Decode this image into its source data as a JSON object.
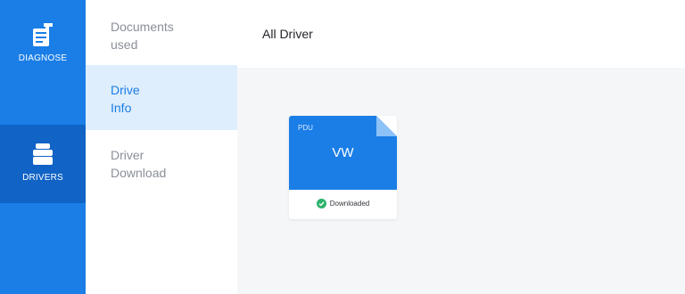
{
  "rail": {
    "items": [
      {
        "label": "DIAGNOSE",
        "icon": "diagnose-icon"
      },
      {
        "label": "DRIVERS",
        "icon": "drivers-icon",
        "active": true
      }
    ]
  },
  "submenu": {
    "items": [
      {
        "label": "Documents\nused"
      },
      {
        "label": "Drive\nInfo",
        "active": true
      },
      {
        "label": "Driver\nDownload"
      }
    ]
  },
  "main": {
    "title": "All Driver",
    "drivers": [
      {
        "tag": "PDU",
        "name": "VW",
        "status": "Downloaded",
        "status_icon": "check-circle-icon"
      }
    ]
  },
  "colors": {
    "primary": "#1a7ee6",
    "primary_dark": "#1163c6",
    "card_blue": "#1a7ee6",
    "active_bg": "#dfeefc",
    "success": "#2db36b"
  }
}
